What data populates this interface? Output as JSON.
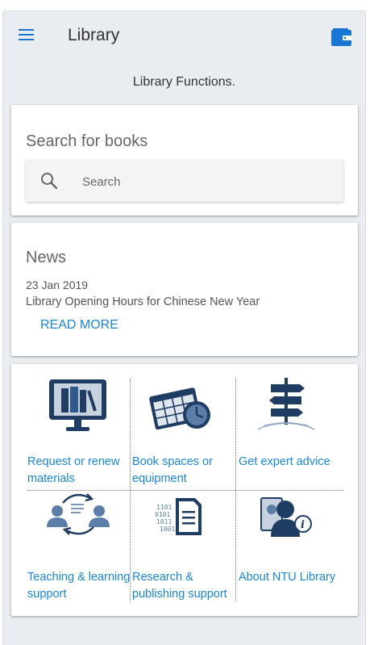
{
  "header": {
    "title": "Library"
  },
  "subtitle": "Library Functions.",
  "search": {
    "title": "Search for books",
    "placeholder": "Search"
  },
  "news": {
    "title": "News",
    "date": "23 Jan 2019",
    "headline": "Library Opening Hours for Chinese New Year",
    "more_label": "READ MORE"
  },
  "tiles": [
    {
      "label": "Request or renew materials",
      "icon": "computer-books-icon"
    },
    {
      "label": "Book spaces or equipment",
      "icon": "calendar-clock-icon"
    },
    {
      "label": "Get expert advice",
      "icon": "signpost-icon"
    },
    {
      "label": "Teaching & learning support",
      "icon": "people-exchange-icon"
    },
    {
      "label": "Research & publishing support",
      "icon": "binary-document-icon"
    },
    {
      "label": "About NTU Library",
      "icon": "person-info-icon"
    }
  ],
  "colors": {
    "accent": "#1a85d8",
    "icon_dark": "#1f3d63",
    "background": "#e9ecf0"
  }
}
